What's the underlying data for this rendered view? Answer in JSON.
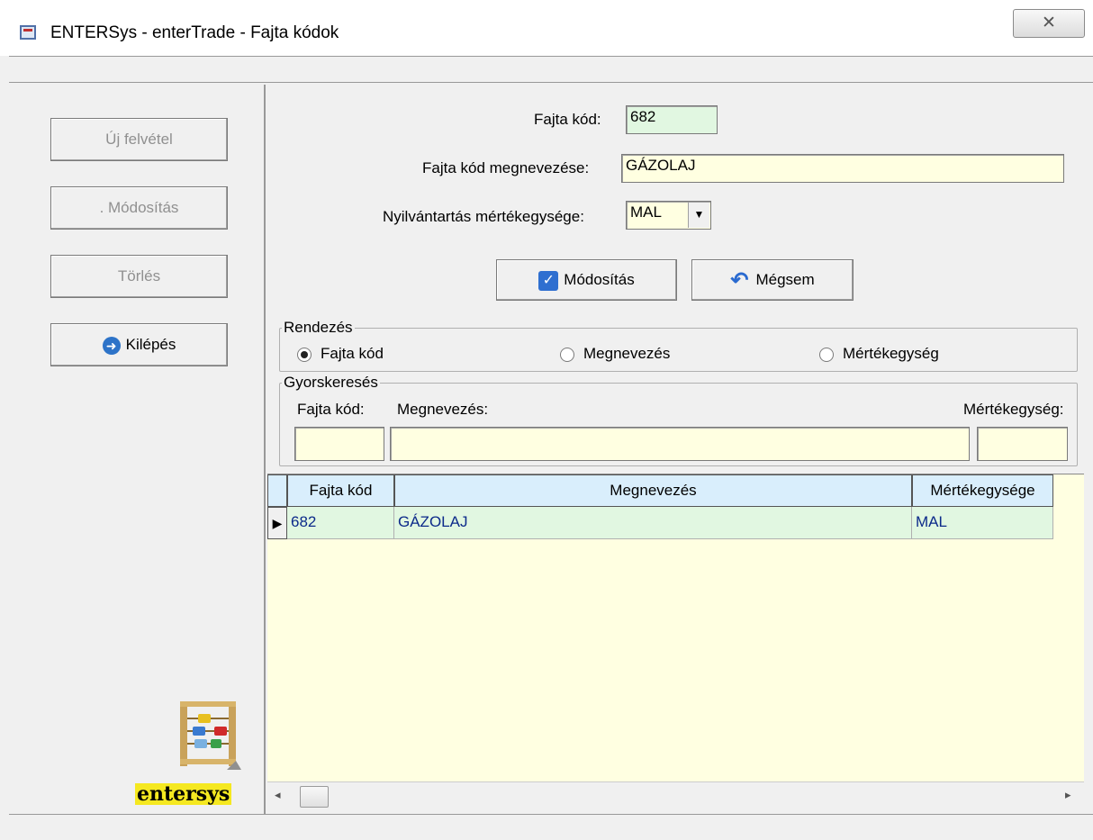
{
  "window": {
    "title": "ENTERSys - enterTrade - Fajta kódok",
    "close_label": "✕"
  },
  "left": {
    "new_label": "Új felvétel",
    "modify_label": ". Módosítás",
    "delete_label": "Törlés",
    "exit_label": "Kilépés",
    "logo_text": "entersys"
  },
  "form": {
    "code_label": "Fajta kód:",
    "code_value": "682",
    "name_label": "Fajta kód megnevezése:",
    "name_value": "GÁZOLAJ",
    "unit_label": "Nyilvántartás mértékegysége:",
    "unit_value": "MAL",
    "save_label": "Módosítás",
    "cancel_label": "Mégsem"
  },
  "sort": {
    "title": "Rendezés",
    "options": [
      "Fajta kód",
      "Megnevezés",
      "Mértékegység"
    ],
    "selected": "Fajta kód"
  },
  "quick_search": {
    "title": "Gyorskeresés",
    "code_label": "Fajta kód:",
    "name_label": "Megnevezés:",
    "unit_label": "Mértékegység:"
  },
  "grid": {
    "columns": [
      "Fajta kód",
      "Megnevezés",
      "Mértékegysége"
    ],
    "rows": [
      {
        "code": "682",
        "name": "GÁZOLAJ",
        "unit": "MAL"
      }
    ]
  },
  "colors": {
    "grid_background": "#ffffe1",
    "row_green": "#e1f7e1",
    "header_blue": "#d9eefc",
    "row_text": "#0c2a8a"
  }
}
